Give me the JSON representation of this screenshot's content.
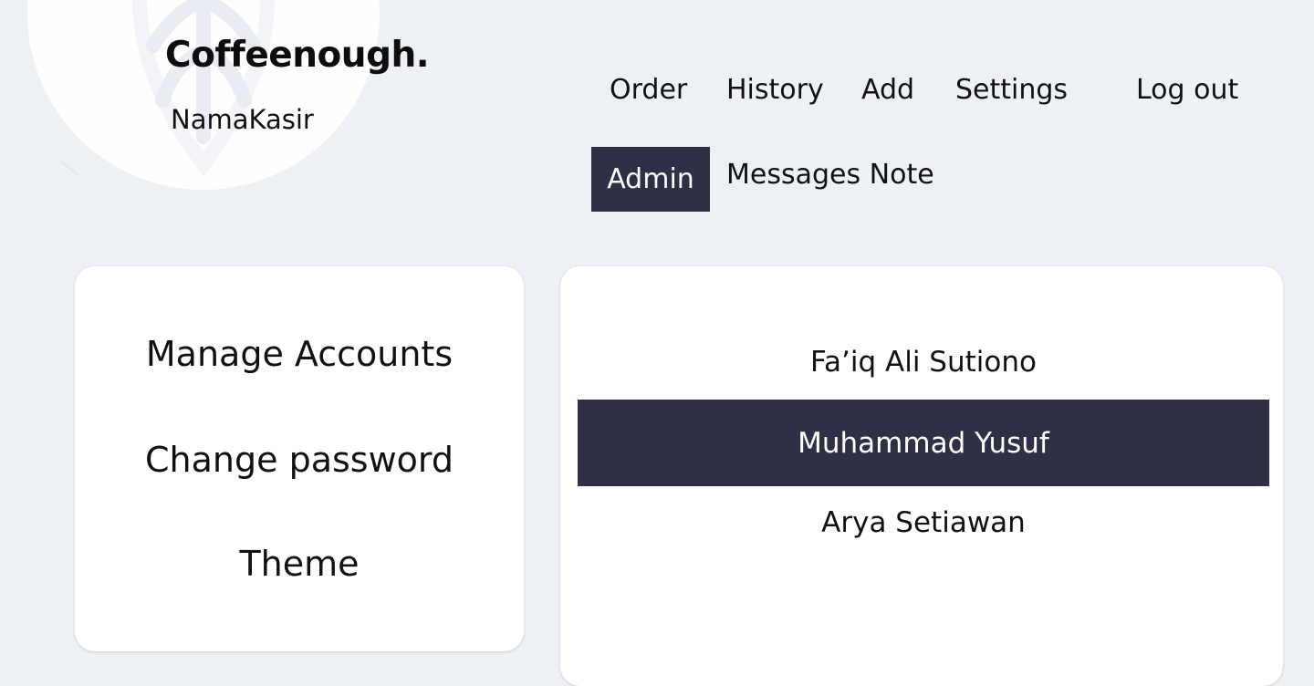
{
  "header": {
    "brand": "Coffeenough.",
    "cashier_name": "NamaKasir",
    "logo_icon": "coffee-leaf-logo-icon"
  },
  "nav": {
    "order": "Order",
    "history": "History",
    "add": "Add",
    "settings": "Settings",
    "logout": "Log out",
    "admin": "Admin",
    "messages_note": "Messages Note",
    "active": "Admin"
  },
  "settings_menu": {
    "manage_accounts": "Manage Accounts",
    "change_password": "Change password",
    "theme": "Theme"
  },
  "accounts": {
    "items": [
      {
        "name": "Fa’iq Ali Sutiono",
        "selected": false
      },
      {
        "name": "Muhammad Yusuf",
        "selected": true
      },
      {
        "name": "Arya Setiawan",
        "selected": false
      }
    ]
  },
  "colors": {
    "background": "#edf1f6",
    "accent": "#2f3045",
    "card": "#ffffff"
  }
}
